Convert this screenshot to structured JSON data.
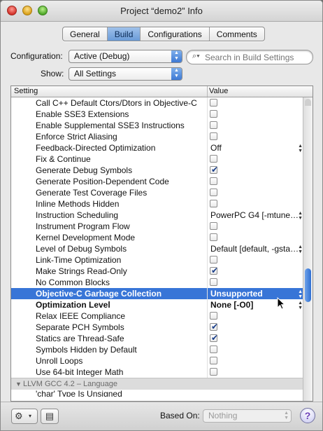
{
  "window": {
    "title": "Project “demo2” Info"
  },
  "tabs": [
    {
      "label": "General",
      "active": false
    },
    {
      "label": "Build",
      "active": true
    },
    {
      "label": "Configurations",
      "active": false
    },
    {
      "label": "Comments",
      "active": false
    }
  ],
  "configuration": {
    "label": "Configuration:",
    "value": "Active (Debug)"
  },
  "show": {
    "label": "Show:",
    "value": "All Settings"
  },
  "search": {
    "placeholder": "Search in Build Settings"
  },
  "table": {
    "col_setting": "Setting",
    "col_value": "Value",
    "rows": [
      {
        "name": "Call C++ Default Ctors/Dtors in Objective-C",
        "type": "check",
        "checked": false
      },
      {
        "name": "Enable SSE3 Extensions",
        "type": "check",
        "checked": false
      },
      {
        "name": "Enable Supplemental SSE3 Instructions",
        "type": "check",
        "checked": false
      },
      {
        "name": "Enforce Strict Aliasing",
        "type": "check",
        "checked": false
      },
      {
        "name": "Feedback-Directed Optimization",
        "type": "text",
        "value": "Off",
        "stepper": true
      },
      {
        "name": "Fix & Continue",
        "type": "check",
        "checked": false
      },
      {
        "name": "Generate Debug Symbols",
        "type": "check",
        "checked": true
      },
      {
        "name": "Generate Position-Dependent Code",
        "type": "check",
        "checked": false
      },
      {
        "name": "Generate Test Coverage Files",
        "type": "check",
        "checked": false
      },
      {
        "name": "Inline Methods Hidden",
        "type": "check",
        "checked": false
      },
      {
        "name": "Instruction Scheduling",
        "type": "text",
        "value": "PowerPC G4 [-mtune…",
        "stepper": true
      },
      {
        "name": "Instrument Program Flow",
        "type": "check",
        "checked": false
      },
      {
        "name": "Kernel Development Mode",
        "type": "check",
        "checked": false
      },
      {
        "name": "Level of Debug Symbols",
        "type": "text",
        "value": "Default [default, -gsta…",
        "stepper": true
      },
      {
        "name": "Link-Time Optimization",
        "type": "check",
        "checked": false
      },
      {
        "name": "Make Strings Read-Only",
        "type": "check",
        "checked": true
      },
      {
        "name": "No Common Blocks",
        "type": "check",
        "checked": false
      },
      {
        "name": "Objective-C Garbage Collection",
        "type": "text",
        "value": "Unsupported",
        "stepper": true,
        "selected": true
      },
      {
        "name": "Optimization Level",
        "type": "text",
        "value": "None [-O0]",
        "stepper": true,
        "bold": true
      },
      {
        "name": "Relax IEEE Compliance",
        "type": "check",
        "checked": false
      },
      {
        "name": "Separate PCH Symbols",
        "type": "check",
        "checked": true
      },
      {
        "name": "Statics are Thread-Safe",
        "type": "check",
        "checked": true
      },
      {
        "name": "Symbols Hidden by Default",
        "type": "check",
        "checked": false
      },
      {
        "name": "Unroll Loops",
        "type": "check",
        "checked": false
      },
      {
        "name": "Use 64-bit Integer Math",
        "type": "check",
        "checked": false
      }
    ],
    "group": {
      "name": "LLVM GCC 4.2 – Language"
    },
    "partial_row": {
      "name": "'char' Type Is Unsigned"
    }
  },
  "bottom": {
    "based_on_label": "Based On:",
    "based_on_value": "Nothing",
    "help_label": "?"
  },
  "icons": {
    "gear": "⚙",
    "dropdown": "▾",
    "document": "▤",
    "search": "⌕",
    "check": "✔",
    "stepper": "▴▾"
  },
  "colors": {
    "selection": "#3875d7",
    "scroll_thumb": "#2f6fd2",
    "close": "#d3332b",
    "minimize": "#d9a11b",
    "maximize": "#4fa82a"
  }
}
